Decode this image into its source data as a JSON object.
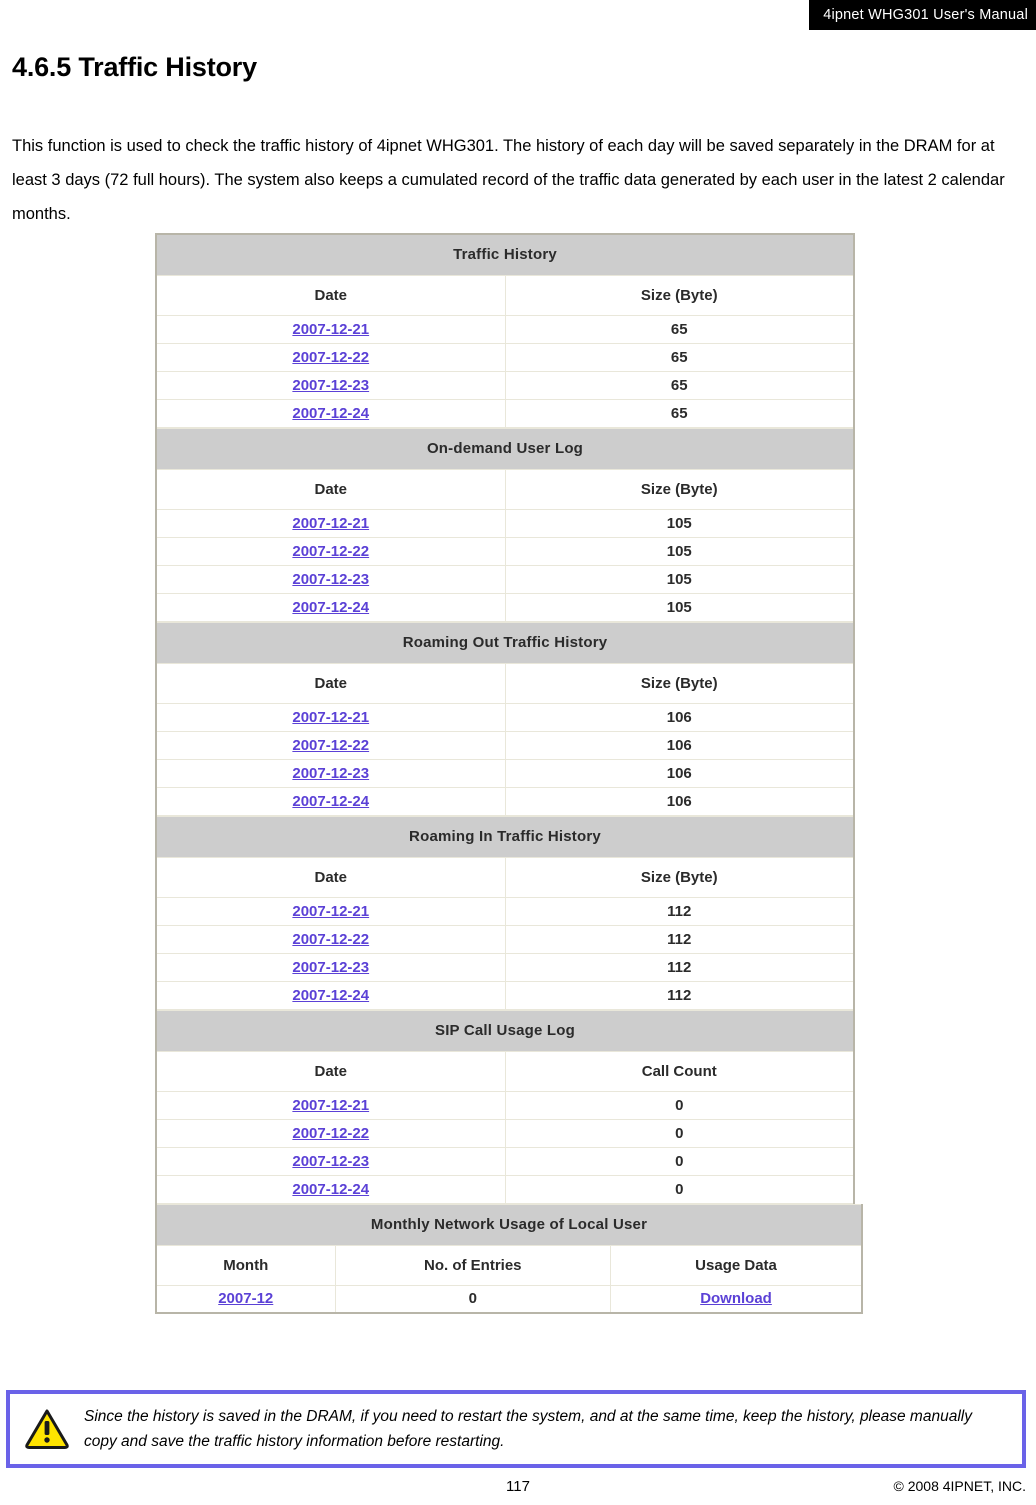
{
  "header": {
    "running_title": "4ipnet WHG301 User's Manual"
  },
  "section": {
    "number_title": "4.6.5 Traffic History",
    "intro": "This function is used to check the traffic history of 4ipnet WHG301. The history of each day will be saved separately in the DRAM for at least 3 days (72 full hours). The system also keeps a cumulated record of the traffic data generated by each user in the latest 2 calendar months."
  },
  "screenshot": {
    "tables": [
      {
        "band_title": "Traffic History",
        "columns": [
          "Date",
          "Size (Byte)"
        ],
        "rows": [
          [
            "2007-12-21",
            "65"
          ],
          [
            "2007-12-22",
            "65"
          ],
          [
            "2007-12-23",
            "65"
          ],
          [
            "2007-12-24",
            "65"
          ]
        ]
      },
      {
        "band_title": "On-demand User Log",
        "columns": [
          "Date",
          "Size (Byte)"
        ],
        "rows": [
          [
            "2007-12-21",
            "105"
          ],
          [
            "2007-12-22",
            "105"
          ],
          [
            "2007-12-23",
            "105"
          ],
          [
            "2007-12-24",
            "105"
          ]
        ]
      },
      {
        "band_title": "Roaming Out Traffic History",
        "columns": [
          "Date",
          "Size (Byte)"
        ],
        "rows": [
          [
            "2007-12-21",
            "106"
          ],
          [
            "2007-12-22",
            "106"
          ],
          [
            "2007-12-23",
            "106"
          ],
          [
            "2007-12-24",
            "106"
          ]
        ]
      },
      {
        "band_title": "Roaming In Traffic History",
        "columns": [
          "Date",
          "Size (Byte)"
        ],
        "rows": [
          [
            "2007-12-21",
            "112"
          ],
          [
            "2007-12-22",
            "112"
          ],
          [
            "2007-12-23",
            "112"
          ],
          [
            "2007-12-24",
            "112"
          ]
        ]
      },
      {
        "band_title": "SIP Call Usage Log",
        "columns": [
          "Date",
          "Call Count"
        ],
        "rows": [
          [
            "2007-12-21",
            "0"
          ],
          [
            "2007-12-22",
            "0"
          ],
          [
            "2007-12-23",
            "0"
          ],
          [
            "2007-12-24",
            "0"
          ]
        ]
      }
    ],
    "monthly_table": {
      "band_title": "Monthly Network Usage of Local User",
      "columns": [
        "Month",
        "No. of Entries",
        "Usage Data"
      ],
      "rows": [
        [
          "2007-12",
          "0",
          "Download"
        ]
      ]
    }
  },
  "note": {
    "icon": "warning-triangle-icon",
    "text": "Since the history is saved in the DRAM, if you need to restart the system, and at the same time, keep the history, please manually copy and save the traffic history information before restarting."
  },
  "footer": {
    "page_number": "117",
    "copyright": "© 2008 4IPNET, INC."
  },
  "colors": {
    "band_gray": "#cdcdcd",
    "grid_line": "#e9e7da",
    "link_blue": "#5b41d6",
    "note_border": "#6a62e8",
    "warning_yellow": "#ffe400",
    "header_black": "#000000"
  }
}
